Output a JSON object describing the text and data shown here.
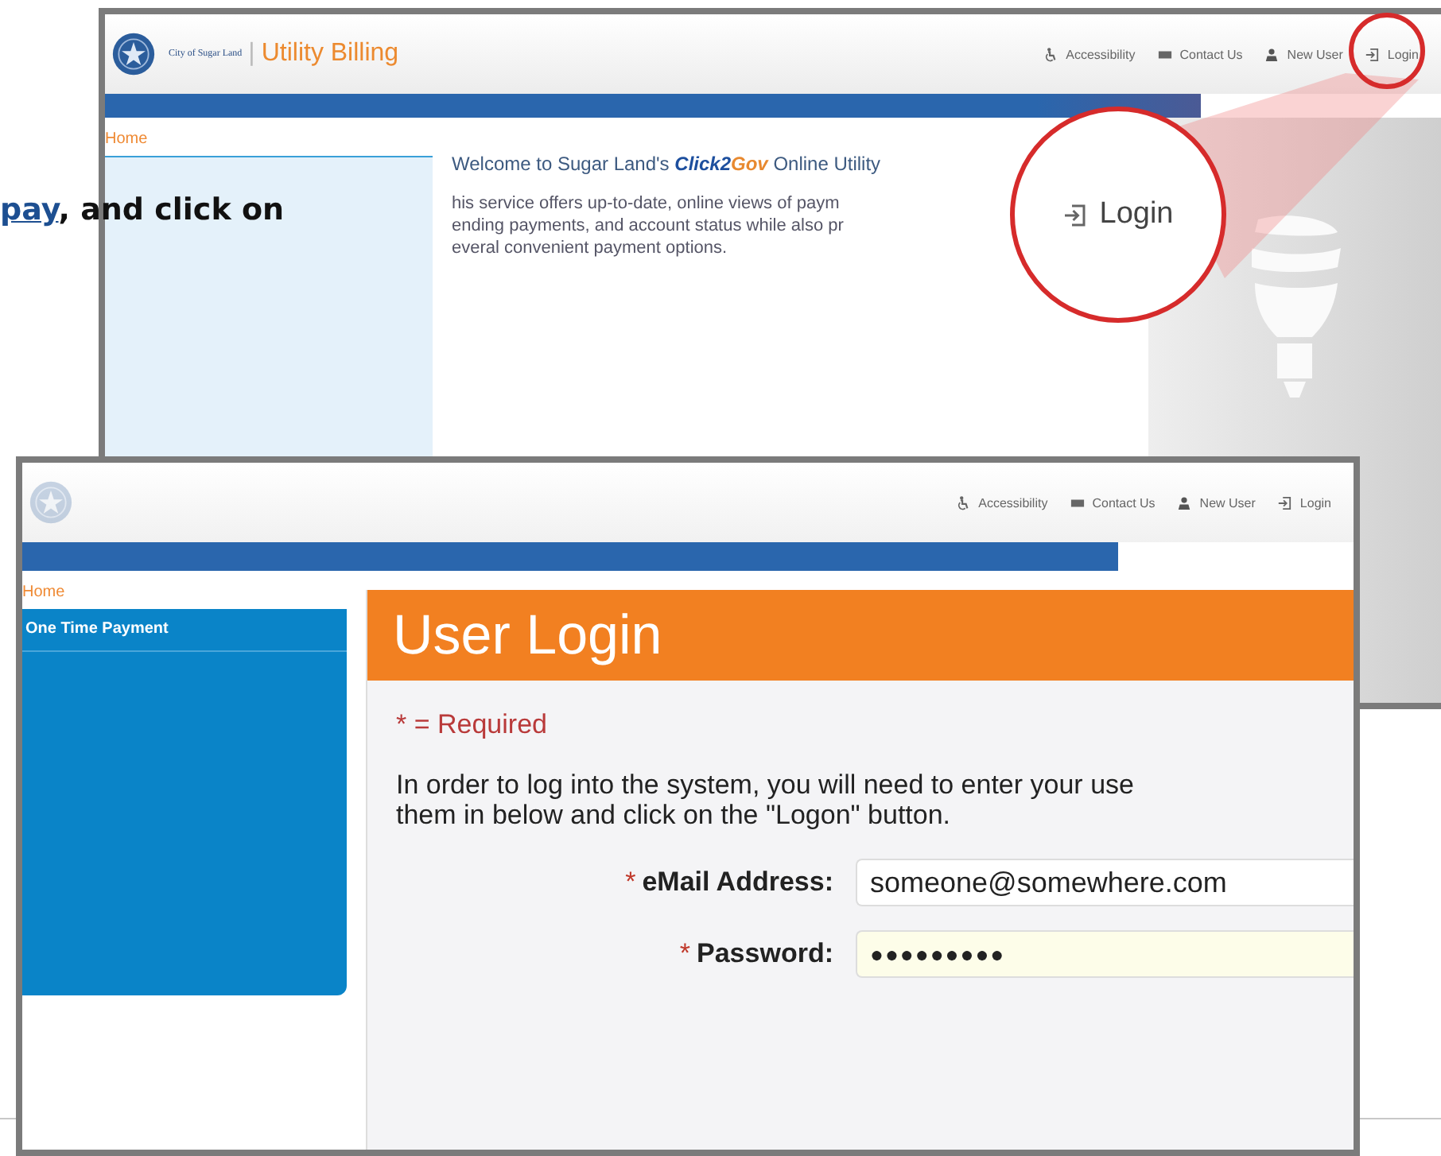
{
  "caption": {
    "link": "pay",
    "text": ", and click on"
  },
  "welcome_screen": {
    "header": {
      "city": "City of Sugar Land",
      "separator": "|",
      "app": "Utility Billing"
    },
    "nav": [
      {
        "kind": "accessibility",
        "label": "Accessibility"
      },
      {
        "kind": "contact",
        "label": "Contact Us"
      },
      {
        "kind": "user",
        "label": "New User"
      },
      {
        "kind": "login",
        "label": "Login"
      }
    ],
    "breadcrumb": "Home",
    "welcome": {
      "prefix": "Welcome to Sugar Land's",
      "brand": "Click2",
      "brand_accent": "Gov",
      "suffix": "Online Utility"
    },
    "description_lines": [
      "his service offers up-to-date, online views of paym",
      "ending payments, and account status while also pr",
      "everal convenient payment options."
    ],
    "zoom_callout": {
      "label": "Login"
    }
  },
  "login_screen": {
    "nav": [
      {
        "kind": "accessibility",
        "label": "Accessibility"
      },
      {
        "kind": "contact",
        "label": "Contact Us"
      },
      {
        "kind": "user",
        "label": "New User"
      },
      {
        "kind": "login",
        "label": "Login"
      }
    ],
    "breadcrumb": "Home",
    "sidebar_items": [
      {
        "label": "One Time Payment"
      }
    ],
    "title": "User Login",
    "required_note": "* = Required",
    "instruction_lines": [
      "In order to log into the system, you will need to enter your use",
      "them in below and click on the \"Logon\" button."
    ],
    "fields": [
      {
        "kind": "text",
        "marker": "*",
        "label": "eMail Address:",
        "value": "someone@somewhere.com"
      },
      {
        "kind": "password",
        "marker": "*",
        "label": "Password:",
        "value": "●●●●●●●●●"
      }
    ]
  }
}
